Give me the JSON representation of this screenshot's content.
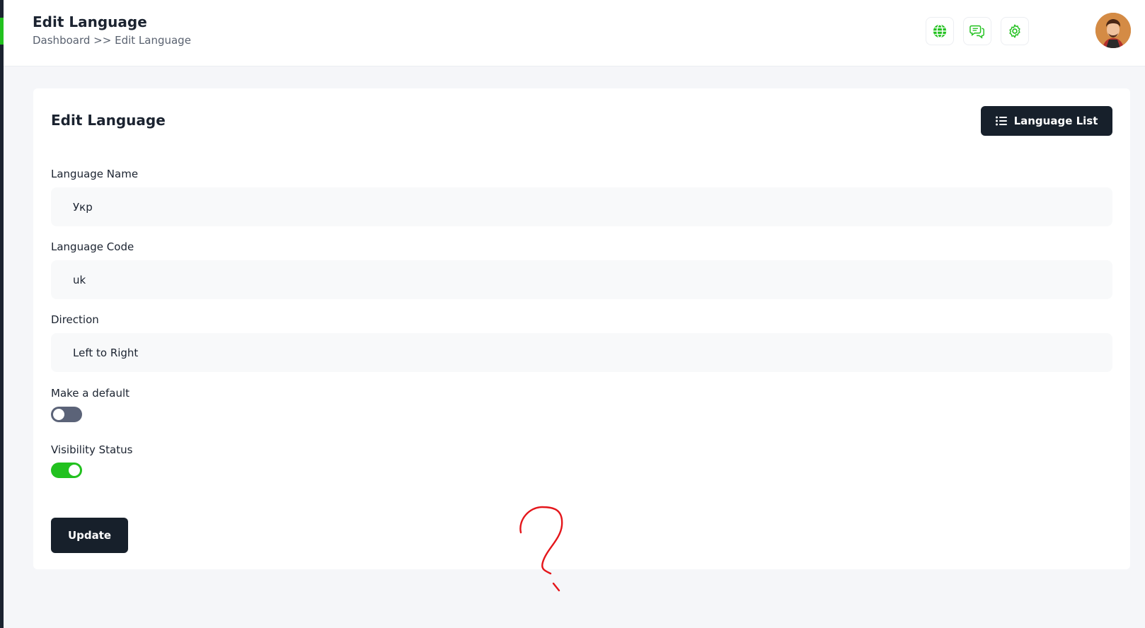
{
  "header": {
    "title": "Edit Language",
    "breadcrumb_root": "Dashboard",
    "breadcrumb_separator": ">>",
    "breadcrumb_current": "Edit Language",
    "icons": [
      "globe-icon",
      "chat-icon",
      "gear-icon"
    ],
    "accent_color": "#22c11f"
  },
  "card": {
    "title": "Edit Language",
    "language_list_label": "Language List"
  },
  "form": {
    "name_label": "Language Name",
    "name_value": "Укр",
    "code_label": "Language Code",
    "code_value": "uk",
    "direction_label": "Direction",
    "direction_value": "Left to Right",
    "default_label": "Make a default",
    "default_on": false,
    "visibility_label": "Visibility Status",
    "visibility_on": true,
    "update_label": "Update"
  },
  "colors": {
    "dark": "#17202b",
    "green": "#22c11f",
    "toggle_off": "#5b6378",
    "annotation": "#e4161b"
  }
}
